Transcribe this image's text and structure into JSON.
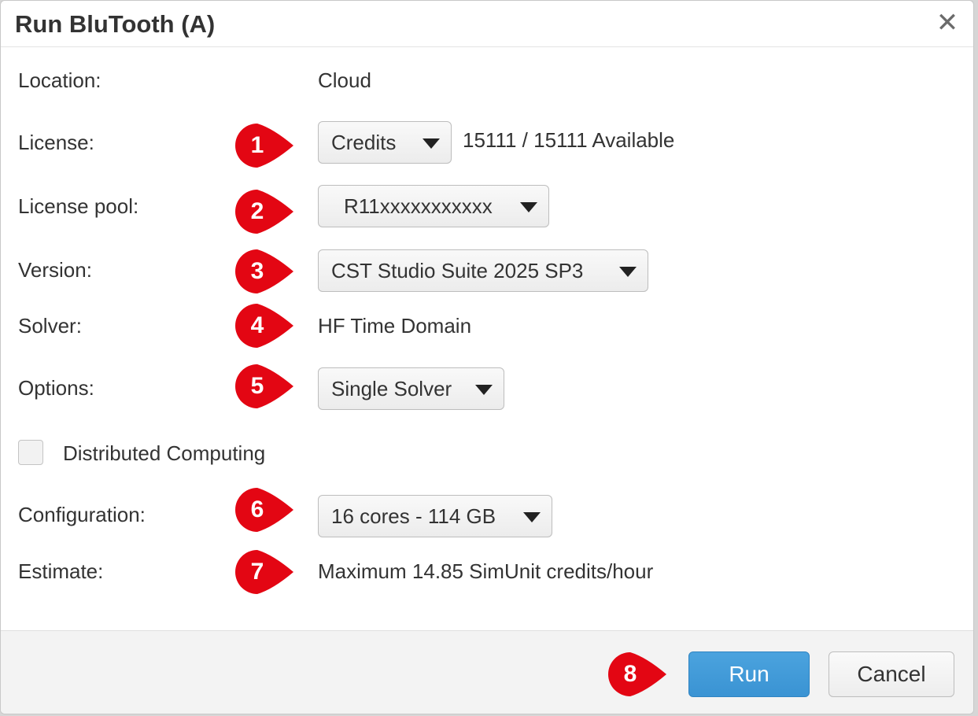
{
  "dialog": {
    "title": "Run BluTooth (A)",
    "close_glyph": "✕"
  },
  "fields": {
    "location": {
      "label": "Location:",
      "value": "Cloud"
    },
    "license": {
      "label": "License:",
      "selected": "Credits",
      "availability": "15111 / 15111 Available"
    },
    "license_pool": {
      "label": "License pool:",
      "selected": "R11xxxxxxxxxxx"
    },
    "version": {
      "label": "Version:",
      "selected": "CST Studio Suite 2025 SP3"
    },
    "solver": {
      "label": "Solver:",
      "value": "HF Time Domain"
    },
    "options": {
      "label": "Options:",
      "selected": "Single Solver"
    },
    "distributed": {
      "label": "Distributed Computing",
      "checked": false
    },
    "configuration": {
      "label": "Configuration:",
      "selected": "16 cores - 114 GB"
    },
    "estimate": {
      "label": "Estimate:",
      "value": "Maximum 14.85 SimUnit credits/hour"
    }
  },
  "markers": [
    "1",
    "2",
    "3",
    "4",
    "5",
    "6",
    "7",
    "8"
  ],
  "buttons": {
    "run": "Run",
    "cancel": "Cancel"
  },
  "colors": {
    "marker": "#e30613",
    "primary_button": "#3d97d6"
  },
  "icons": {
    "close": "close-icon",
    "dropdown": "chevron-down-icon"
  }
}
